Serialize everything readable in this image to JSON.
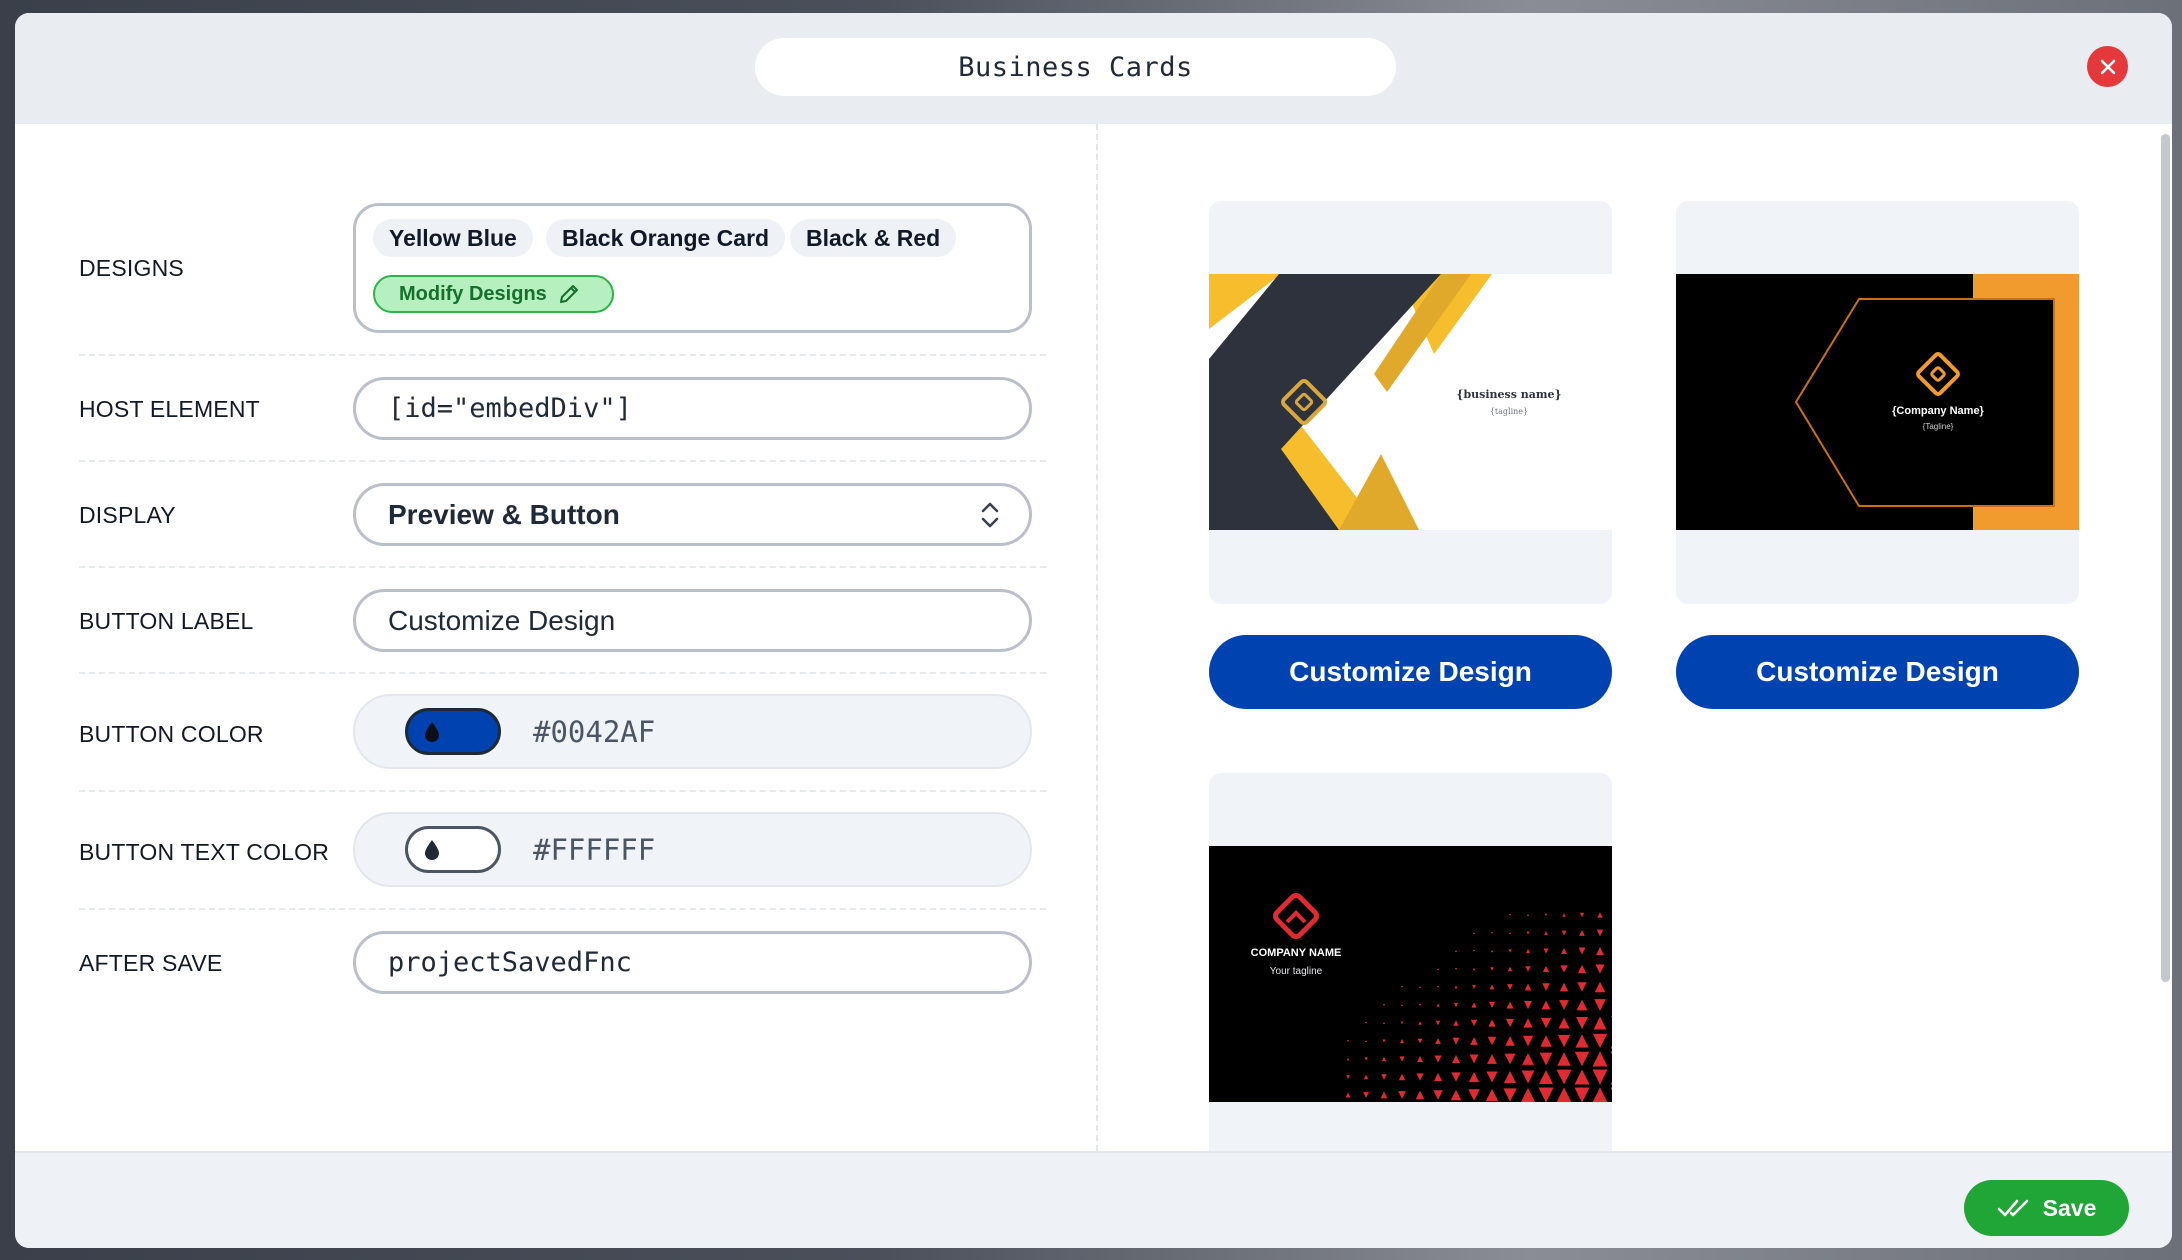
{
  "header": {
    "title": "Business Cards"
  },
  "form": {
    "designs": {
      "label": "DESIGNS",
      "chips": [
        "Yellow Blue",
        "Black Orange Card",
        "Black & Red"
      ],
      "modify_label": "Modify Designs"
    },
    "host_element": {
      "label": "HOST ELEMENT",
      "value": "[id=\"embedDiv\"]"
    },
    "display": {
      "label": "DISPLAY",
      "value": "Preview & Button"
    },
    "button_label": {
      "label": "BUTTON LABEL",
      "value": "Customize Design"
    },
    "button_color": {
      "label": "BUTTON COLOR",
      "value": "#0042AF"
    },
    "button_text_color": {
      "label": "BUTTON TEXT COLOR",
      "value": "#FFFFFF"
    },
    "after_save": {
      "label": "AFTER SAVE",
      "value": "projectSavedFnc"
    }
  },
  "preview": {
    "cards": [
      {
        "design": "Yellow Blue",
        "business_name": "{business name}",
        "tagline": "{tagline}",
        "button_label": "Customize Design"
      },
      {
        "design": "Black Orange Card",
        "business_name": "{Company Name}",
        "tagline": "{Tagline}",
        "button_label": "Customize Design"
      },
      {
        "design": "Black & Red",
        "business_name": "COMPANY NAME",
        "tagline": "Your tagline"
      }
    ]
  },
  "footer": {
    "save_label": "Save"
  },
  "colors": {
    "accent": "#0042AF",
    "save": "#1FA637",
    "close": "#E5383B",
    "yellow": "#F6BE2C",
    "dark_slate": "#2E323D",
    "orange": "#F19A2E",
    "red": "#E12B33"
  }
}
